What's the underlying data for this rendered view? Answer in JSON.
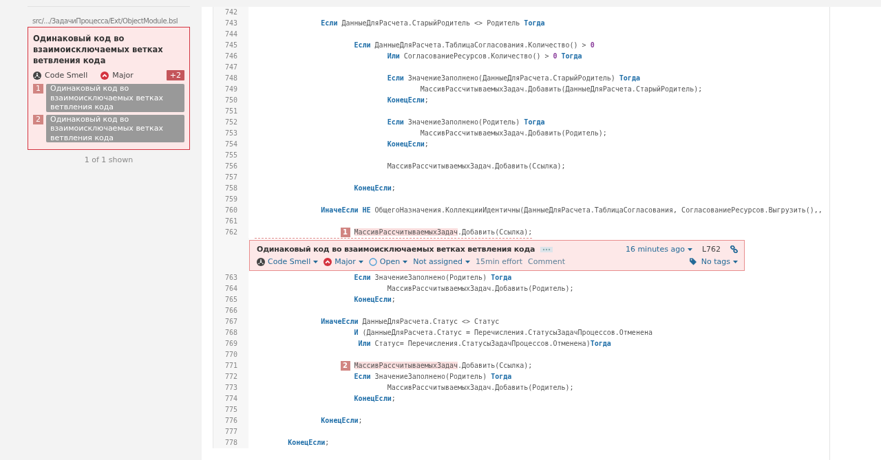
{
  "sidebar": {
    "file_path": "src/.../ЗадачиПроцесса/Ext/ObjectModule.bsl",
    "issue": {
      "selected": true,
      "title": "Одинаковый код во взаимоисключаемых ветках ветвления кода",
      "type": "Code Smell",
      "severity": "Major",
      "extra_count": "+2",
      "locations": [
        {
          "index": "1",
          "message": "Одинаковый код во взаимоисключаемых ветках ветвления кода"
        },
        {
          "index": "2",
          "message": "Одинаковый код во взаимоисключаемых ветках ветвления кода"
        }
      ]
    },
    "footer": "1 of 1 shown"
  },
  "code": {
    "lines": [
      {
        "kind": "code",
        "number": "742"
      },
      {
        "kind": "code",
        "number": "743",
        "segments": [
          {
            "kind": "keyword",
            "text": "                Если"
          },
          {
            "kind": "plain",
            "text": " ДанныеДляРасчета.СтарыйРодитель <> Родитель "
          },
          {
            "kind": "keyword",
            "text": "Тогда"
          }
        ]
      },
      {
        "kind": "code",
        "number": "744"
      },
      {
        "kind": "code",
        "number": "745",
        "segments": [
          {
            "kind": "keyword",
            "text": "                        Если"
          },
          {
            "kind": "plain",
            "text": " ДанныеДляРасчета.ТаблицаСогласования.Количество() > "
          },
          {
            "kind": "number",
            "text": "0"
          }
        ]
      },
      {
        "kind": "code",
        "number": "746",
        "segments": [
          {
            "kind": "keyword",
            "text": "                                Или"
          },
          {
            "kind": "plain",
            "text": " СогласованиеРесурсов.Количество() > "
          },
          {
            "kind": "number",
            "text": "0"
          },
          {
            "kind": "keyword",
            "text": " Тогда"
          }
        ]
      },
      {
        "kind": "code",
        "number": "747"
      },
      {
        "kind": "code",
        "number": "748",
        "segments": [
          {
            "kind": "keyword",
            "text": "                                Если"
          },
          {
            "kind": "plain",
            "text": " ЗначениеЗаполнено(ДанныеДляРасчета.СтарыйРодитель) "
          },
          {
            "kind": "keyword",
            "text": "Тогда"
          }
        ]
      },
      {
        "kind": "code",
        "number": "749",
        "segments": [
          {
            "kind": "plain",
            "text": "                                        МассивРассчитываемыхЗадач.Добавить(ДанныеДляРасчета.СтарыйРодитель);"
          }
        ]
      },
      {
        "kind": "code",
        "number": "750",
        "segments": [
          {
            "kind": "keyword",
            "text": "                                КонецЕсли"
          },
          {
            "kind": "plain",
            "text": ";"
          }
        ]
      },
      {
        "kind": "code",
        "number": "751"
      },
      {
        "kind": "code",
        "number": "752",
        "segments": [
          {
            "kind": "keyword",
            "text": "                                Если"
          },
          {
            "kind": "plain",
            "text": " ЗначениеЗаполнено(Родитель) "
          },
          {
            "kind": "keyword",
            "text": "Тогда"
          }
        ]
      },
      {
        "kind": "code",
        "number": "753",
        "segments": [
          {
            "kind": "plain",
            "text": "                                        МассивРассчитываемыхЗадач.Добавить(Родитель);"
          }
        ]
      },
      {
        "kind": "code",
        "number": "754",
        "segments": [
          {
            "kind": "keyword",
            "text": "                                КонецЕсли"
          },
          {
            "kind": "plain",
            "text": ";"
          }
        ]
      },
      {
        "kind": "code",
        "number": "755"
      },
      {
        "kind": "code",
        "number": "756",
        "segments": [
          {
            "kind": "plain",
            "text": "                                МассивРассчитываемыхЗадач.Добавить(Ссылка);"
          }
        ]
      },
      {
        "kind": "code",
        "number": "757"
      },
      {
        "kind": "code",
        "number": "758",
        "segments": [
          {
            "kind": "keyword",
            "text": "                        КонецЕсли"
          },
          {
            "kind": "plain",
            "text": ";"
          }
        ]
      },
      {
        "kind": "code",
        "number": "759"
      },
      {
        "kind": "code",
        "number": "760",
        "segments": [
          {
            "kind": "keyword",
            "text": "                ИначеЕсли НЕ"
          },
          {
            "kind": "plain",
            "text": " ОбщегоНазначения.КоллекцииИдентичны(ДанныеДляРасчета.ТаблицаСогласования, СогласованиеРесурсов.Выгрузить(),,"
          }
        ]
      },
      {
        "kind": "code",
        "number": "761"
      },
      {
        "kind": "code",
        "number": "762",
        "marker": "1",
        "flagged": true,
        "segments": [
          {
            "kind": "highlight",
            "text": "                        МассивРассчитываемыхЗадач"
          },
          {
            "kind": "plain",
            "text": ".Добавить(Ссылка);"
          }
        ]
      },
      {
        "kind": "issue",
        "title": "Одинаковый код во взаимоисключаемых ветках ветвления кода",
        "age": "16 minutes ago",
        "line": "L762",
        "type": "Code Smell",
        "severity": "Major",
        "status": "Open",
        "assignee": "Not assigned",
        "effort": "15min effort",
        "comment": "Comment",
        "tags": "No tags"
      },
      {
        "kind": "code",
        "number": "763",
        "segments": [
          {
            "kind": "keyword",
            "text": "                        Если"
          },
          {
            "kind": "plain",
            "text": " ЗначениеЗаполнено(Родитель) "
          },
          {
            "kind": "keyword",
            "text": "Тогда"
          }
        ]
      },
      {
        "kind": "code",
        "number": "764",
        "segments": [
          {
            "kind": "plain",
            "text": "                                МассивРассчитываемыхЗадач.Добавить(Родитель);"
          }
        ]
      },
      {
        "kind": "code",
        "number": "765",
        "segments": [
          {
            "kind": "keyword",
            "text": "                        КонецЕсли"
          },
          {
            "kind": "plain",
            "text": ";"
          }
        ]
      },
      {
        "kind": "code",
        "number": "766"
      },
      {
        "kind": "code",
        "number": "767",
        "segments": [
          {
            "kind": "keyword",
            "text": "                ИначеЕсли"
          },
          {
            "kind": "plain",
            "text": " ДанныеДляРасчета.Статус <> Статус"
          }
        ]
      },
      {
        "kind": "code",
        "number": "768",
        "segments": [
          {
            "kind": "keyword",
            "text": "                        И"
          },
          {
            "kind": "plain",
            "text": " (ДанныеДляРасчета.Статус = Перечисления.СтатусыЗадачПроцессов.Отменена"
          }
        ]
      },
      {
        "kind": "code",
        "number": "769",
        "segments": [
          {
            "kind": "keyword",
            "text": "                         Или"
          },
          {
            "kind": "plain",
            "text": " Статус= Перечисления.СтатусыЗадачПроцессов.Отменена)"
          },
          {
            "kind": "keyword",
            "text": "Тогда"
          }
        ]
      },
      {
        "kind": "code",
        "number": "770"
      },
      {
        "kind": "code",
        "number": "771",
        "marker": "2",
        "flagged": false,
        "segments": [
          {
            "kind": "highlight",
            "text": "                        МассивРассчитываемыхЗадач"
          },
          {
            "kind": "plain",
            "text": ".Добавить(Ссылка);"
          }
        ]
      },
      {
        "kind": "code",
        "number": "772",
        "segments": [
          {
            "kind": "keyword",
            "text": "                        Если"
          },
          {
            "kind": "plain",
            "text": " ЗначениеЗаполнено(Родитель) "
          },
          {
            "kind": "keyword",
            "text": "Тогда"
          }
        ]
      },
      {
        "kind": "code",
        "number": "773",
        "segments": [
          {
            "kind": "plain",
            "text": "                                МассивРассчитываемыхЗадач.Добавить(Родитель);"
          }
        ]
      },
      {
        "kind": "code",
        "number": "774",
        "segments": [
          {
            "kind": "keyword",
            "text": "                        КонецЕсли"
          },
          {
            "kind": "plain",
            "text": ";"
          }
        ]
      },
      {
        "kind": "code",
        "number": "775"
      },
      {
        "kind": "code",
        "number": "776",
        "segments": [
          {
            "kind": "keyword",
            "text": "                КонецЕсли"
          },
          {
            "kind": "plain",
            "text": ";"
          }
        ]
      },
      {
        "kind": "code",
        "number": "777"
      },
      {
        "kind": "code",
        "number": "778",
        "segments": [
          {
            "kind": "keyword",
            "text": "        КонецЕсли"
          },
          {
            "kind": "plain",
            "text": ";"
          }
        ]
      }
    ]
  }
}
